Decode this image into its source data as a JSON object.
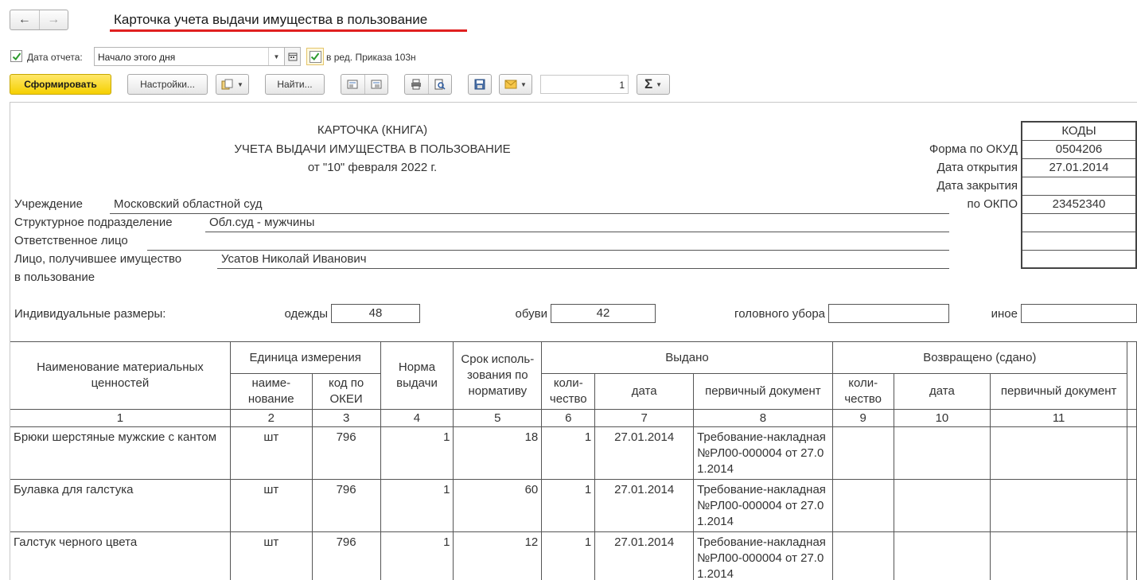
{
  "window": {
    "title": "Карточка учета выдачи имущества в пользование"
  },
  "params": {
    "report_date_label": "Дата отчета:",
    "report_date_value": "Начало этого дня",
    "order_label": "в ред. Приказа 103н"
  },
  "toolbar": {
    "generate": "Сформировать",
    "settings": "Настройки...",
    "find": "Найти...",
    "page_number": "1",
    "sum_symbol": "Σ"
  },
  "report": {
    "title1": "КАРТОЧКА (КНИГА)",
    "title2": "УЧЕТА ВЫДАЧИ ИМУЩЕСТВА В ПОЛЬЗОВАНИЕ",
    "date_line": "от \"10\" февраля 2022 г.",
    "codes_header": "КОДЫ",
    "okud_label": "Форма по ОКУД",
    "okud_value": "0504206",
    "open_date_label": "Дата открытия",
    "open_date_value": "27.01.2014",
    "close_date_label": "Дата закрытия",
    "okpo_label": "по ОКПО",
    "okpo_value": "23452340",
    "institution_label": "Учреждение",
    "institution_value": "Московский областной суд",
    "division_label": "Структурное подразделение",
    "division_value": "Обл.суд - мужчины",
    "responsible_label": "Ответственное лицо",
    "recipient_label": "Лицо, получившее имущество",
    "recipient_label2": "в пользование",
    "recipient_value": "Усатов Николай Иванович",
    "sizes_label": "Индивидуальные размеры:",
    "clothes_label": "одежды",
    "clothes_value": "48",
    "shoes_label": "обуви",
    "shoes_value": "42",
    "headwear_label": "головного убора",
    "other_label": "иное"
  },
  "table": {
    "headers": {
      "name": "Наименование материальных ценностей",
      "unit": "Единица измерения",
      "unit_name": "наиме-нование",
      "okei": "код по ОКЕИ",
      "norm": "Норма выдачи",
      "term": "Срок исполь-зования по нормативу",
      "issued": "Выдано",
      "returned": "Возвращено (сдано)",
      "qty": "коли-чество",
      "date": "дата",
      "doc": "первичный документ"
    },
    "col_numbers": [
      "1",
      "2",
      "3",
      "4",
      "5",
      "6",
      "7",
      "8",
      "9",
      "10",
      "11"
    ],
    "rows": [
      {
        "name": "Брюки шерстяные мужские с кантом",
        "unit": "шт",
        "okei": "796",
        "norm": "1",
        "term": "18",
        "qty": "1",
        "date": "27.01.2014",
        "doc": "Требование-накладная №РЛ00-000004 от 27.01.2014"
      },
      {
        "name": "Булавка для галстука",
        "unit": "шт",
        "okei": "796",
        "norm": "1",
        "term": "60",
        "qty": "1",
        "date": "27.01.2014",
        "doc": "Требование-накладная №РЛ00-000004 от 27.01.2014"
      },
      {
        "name": "Галстук черного цвета",
        "unit": "шт",
        "okei": "796",
        "norm": "1",
        "term": "12",
        "qty": "1",
        "date": "27.01.2014",
        "doc": "Требование-накладная №РЛ00-000004 от 27.01.2014"
      }
    ]
  },
  "colors": {
    "accent_yellow": "#f5d000",
    "title_underline": "#e02020",
    "check_green": "#2e9a2e"
  }
}
